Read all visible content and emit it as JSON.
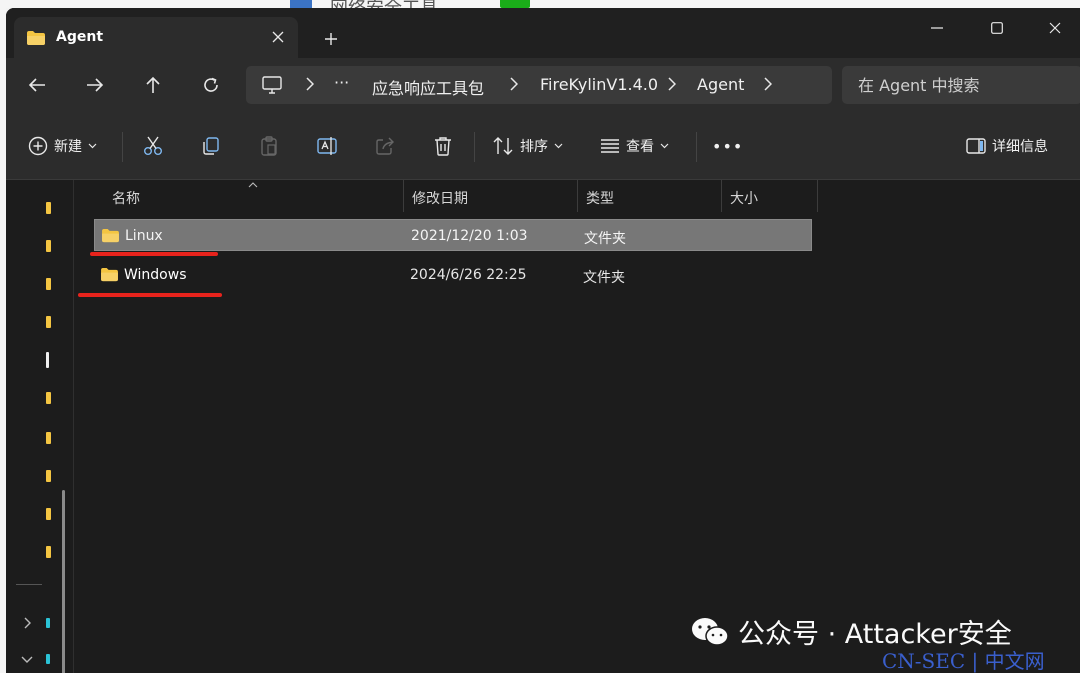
{
  "background_window": {
    "peek_title": "网络安全工具"
  },
  "tab": {
    "title": "Agent"
  },
  "address_bar": {
    "more": "···",
    "segments": [
      "应急响应工具包",
      "FireKylinV1.4.0",
      "Agent"
    ]
  },
  "search": {
    "placeholder": "在 Agent 中搜索"
  },
  "toolbar": {
    "new_label": "新建",
    "sort_label": "排序",
    "view_label": "查看",
    "more_label": "•••",
    "details_label": "详细信息"
  },
  "columns": {
    "name": "名称",
    "modified": "修改日期",
    "type": "类型",
    "size": "大小"
  },
  "files": [
    {
      "name": "Linux",
      "modified": "2021/12/20 1:03",
      "type": "文件夹",
      "size": "",
      "selected": true
    },
    {
      "name": "Windows",
      "modified": "2024/6/26 22:25",
      "type": "文件夹",
      "size": "",
      "selected": false
    }
  ],
  "watermark": {
    "text": "公众号 · Attacker安全",
    "site": "CN-SEC | 中文网"
  },
  "colors": {
    "folder": "#f4c542",
    "annotation": "#e8231c",
    "selection": "#777777"
  }
}
